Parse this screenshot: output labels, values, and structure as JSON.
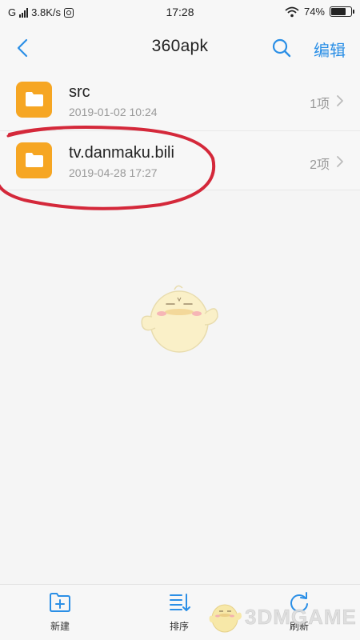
{
  "status_bar": {
    "network": "G",
    "speed": "3.8K/s",
    "time": "17:28",
    "battery": "74%",
    "battery_level": 0.74
  },
  "header": {
    "title": "360apk",
    "edit_label": "编辑"
  },
  "files": [
    {
      "name": "src",
      "date": "2019-01-02 10:24",
      "count": "1项"
    },
    {
      "name": "tv.danmaku.bili",
      "date": "2019-04-28 17:27",
      "count": "2项"
    }
  ],
  "bottom_bar": {
    "new_label": "新建",
    "sort_label": "排序",
    "refresh_label": "刷新"
  },
  "watermark": {
    "text": "3DMGAME"
  },
  "colors": {
    "accent": "#2b8fe6",
    "folder": "#f6a623",
    "annotation": "#d4283a"
  }
}
